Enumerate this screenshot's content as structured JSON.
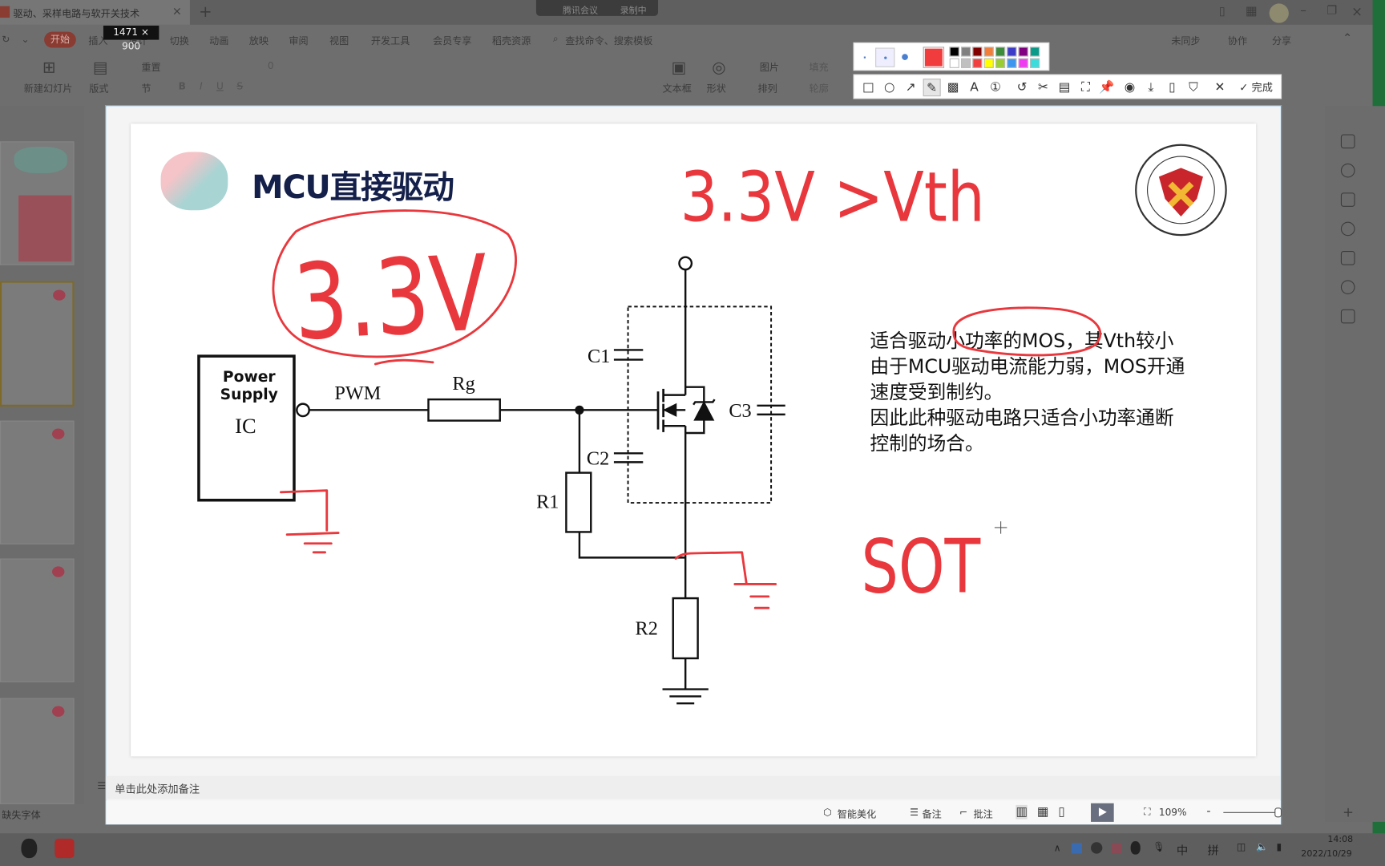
{
  "window": {
    "tab_title": "驱动、采样电路与软开关技术",
    "new_tab": "+",
    "meeting": {
      "name": "腾讯会议",
      "recording": "录制中"
    },
    "size_tooltip": "1471 × 900"
  },
  "menu": {
    "items": [
      "开始",
      "插入",
      "设计",
      "切换",
      "动画",
      "放映",
      "审阅",
      "视图",
      "开发工具",
      "会员专享",
      "稻壳资源"
    ],
    "search": "查找命令、搜索模板",
    "right": [
      "未同步",
      "协作",
      "分享"
    ]
  },
  "ribbon": {
    "new_slide": "新建幻灯片",
    "layout": "版式",
    "section": "节",
    "reset": "重置",
    "textbox": "文本框",
    "shape": "形状",
    "arrange": "排列",
    "picture": "图片",
    "fill": "填充",
    "outline": "轮廓",
    "font_size": "0"
  },
  "annotation_toolbar": {
    "done": "完成",
    "colors": [
      "#000000",
      "#808080",
      "#800000",
      "#f07f3c",
      "#3c8c3c",
      "#3c3cc8",
      "#800080",
      "#0a9a8a",
      "#ffffff",
      "#c0c0c0",
      "#f04040",
      "#ffff00",
      "#9acd32",
      "#3c96f0",
      "#f03cf0",
      "#3cdcdc"
    ],
    "selected_color": "#f03c3c"
  },
  "slide": {
    "title": "MCU直接驱动",
    "body": [
      "适合驱动小功率的MOS，其Vth较小",
      "由于MCU驱动电流能力弱，MOS开通",
      "速度受到制约。",
      "因此此种驱动电路只适合小功率通断",
      "控制的场合。"
    ],
    "circuit": {
      "power": "Power",
      "supply": "Supply",
      "ic": "IC",
      "pwm": "PWM",
      "rg": "Rg",
      "r1": "R1",
      "r2": "R2",
      "c1": "C1",
      "c2": "C2",
      "c3": "C3"
    },
    "ink": {
      "color": "#e8383d",
      "notes": [
        "3.3V",
        "3.3V >Vth",
        "SOT"
      ]
    }
  },
  "notes_placeholder": "单击此处添加备注",
  "status": {
    "missing_font": "缺失字体",
    "beautify": "智能美化",
    "notes": "备注",
    "comment": "批注",
    "zoom": "109%",
    "plus": "+",
    "minus": "-"
  },
  "taskbar": {
    "ime1": "中",
    "ime2": "拼",
    "time": "14:08",
    "date": "2022/10/29"
  }
}
